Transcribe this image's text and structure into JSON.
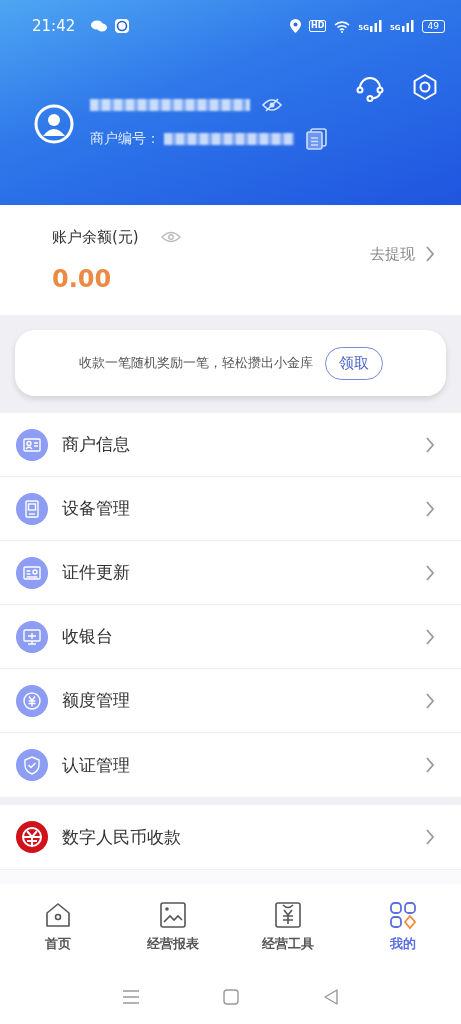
{
  "status_bar": {
    "time": "21:42",
    "hd": "HD",
    "networks": [
      "5G",
      "5G"
    ],
    "battery": "49"
  },
  "profile": {
    "merchant_label": "商户编号："
  },
  "balance": {
    "label": "账户余额(元)",
    "amount": "0.00",
    "withdraw": "去提现"
  },
  "banner": {
    "text": "收款一笔随机奖励一笔，轻松攒出小金库",
    "button": "领取"
  },
  "menu": [
    {
      "label": "商户信息"
    },
    {
      "label": "设备管理"
    },
    {
      "label": "证件更新"
    },
    {
      "label": "收银台"
    },
    {
      "label": "额度管理"
    },
    {
      "label": "认证管理"
    }
  ],
  "extra_menu": [
    {
      "label": "数字人民币收款"
    }
  ],
  "tabs": [
    {
      "label": "首页",
      "selected": false
    },
    {
      "label": "经营报表",
      "selected": false
    },
    {
      "label": "经营工具",
      "selected": false
    },
    {
      "label": "我的",
      "selected": true
    }
  ]
}
